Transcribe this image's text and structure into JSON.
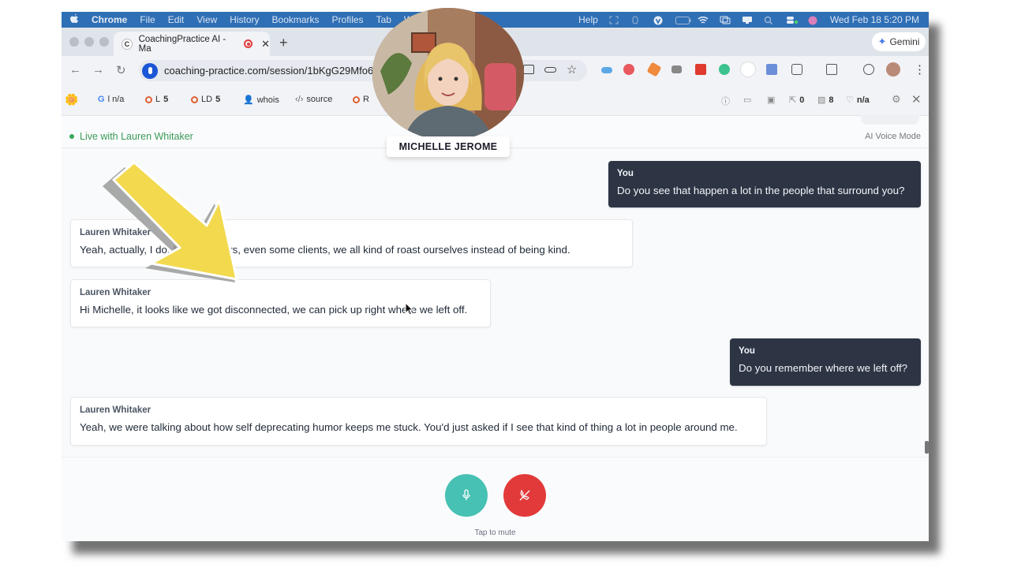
{
  "menubar": {
    "app": "Chrome",
    "items": [
      "File",
      "Edit",
      "View",
      "History",
      "Bookmarks",
      "Profiles",
      "Tab",
      "Wi"
    ],
    "help": "Help",
    "clock": "Wed Feb 18  5:20 PM"
  },
  "tab": {
    "favicon": "C",
    "title": "CoachingPractice AI - Ma",
    "close": "✕",
    "new_tab": "+"
  },
  "gemini": {
    "label": "Gemini"
  },
  "address": {
    "url": "coaching-practice.com/session/1bKgG29Mfo6o"
  },
  "bookmarks": [
    {
      "icon": "google-icon",
      "label": "l n/a"
    },
    {
      "icon": "circle-icon",
      "label": "L",
      "value": "5"
    },
    {
      "icon": "circle-icon",
      "label": "LD",
      "value": "5"
    },
    {
      "icon": "person-icon",
      "label": "whois"
    },
    {
      "icon": "code-icon",
      "label": "source"
    },
    {
      "icon": "circle-icon",
      "label": "R"
    }
  ],
  "bookmarks_right": {
    "links": "0",
    "images": "8",
    "heart": "n/a"
  },
  "session": {
    "live_label": "Live with Lauren Whitaker",
    "mode": "AI Voice Mode"
  },
  "messages": [
    {
      "role": "user",
      "speaker": "You",
      "text": "Do you see that happen a lot in the people that surround you?"
    },
    {
      "role": "ai",
      "speaker": "Lauren Whitaker",
      "text": "Yeah, actually, I do. My coworkers, even some clients, we all kind of roast ourselves instead of being kind."
    },
    {
      "role": "ai",
      "speaker": "Lauren Whitaker",
      "text": "Hi Michelle, it looks like we got disconnected, we can pick up right where we left off."
    },
    {
      "role": "user",
      "speaker": "You",
      "text": "Do you remember where we left off?"
    },
    {
      "role": "ai",
      "speaker": "Lauren Whitaker",
      "text": "Yeah, we were talking about how self deprecating humor keeps me stuck. You'd just asked if I see that kind of thing a lot in people around me."
    }
  ],
  "controls": {
    "hint": "Tap to mute"
  },
  "presenter": {
    "name": "MICHELLE JEROME"
  },
  "colors": {
    "user_bubble": "#2d3545",
    "mic": "#47c1b3",
    "end_call": "#e23a3a",
    "live": "#3c9a58",
    "arrow": "#f2d94e"
  }
}
